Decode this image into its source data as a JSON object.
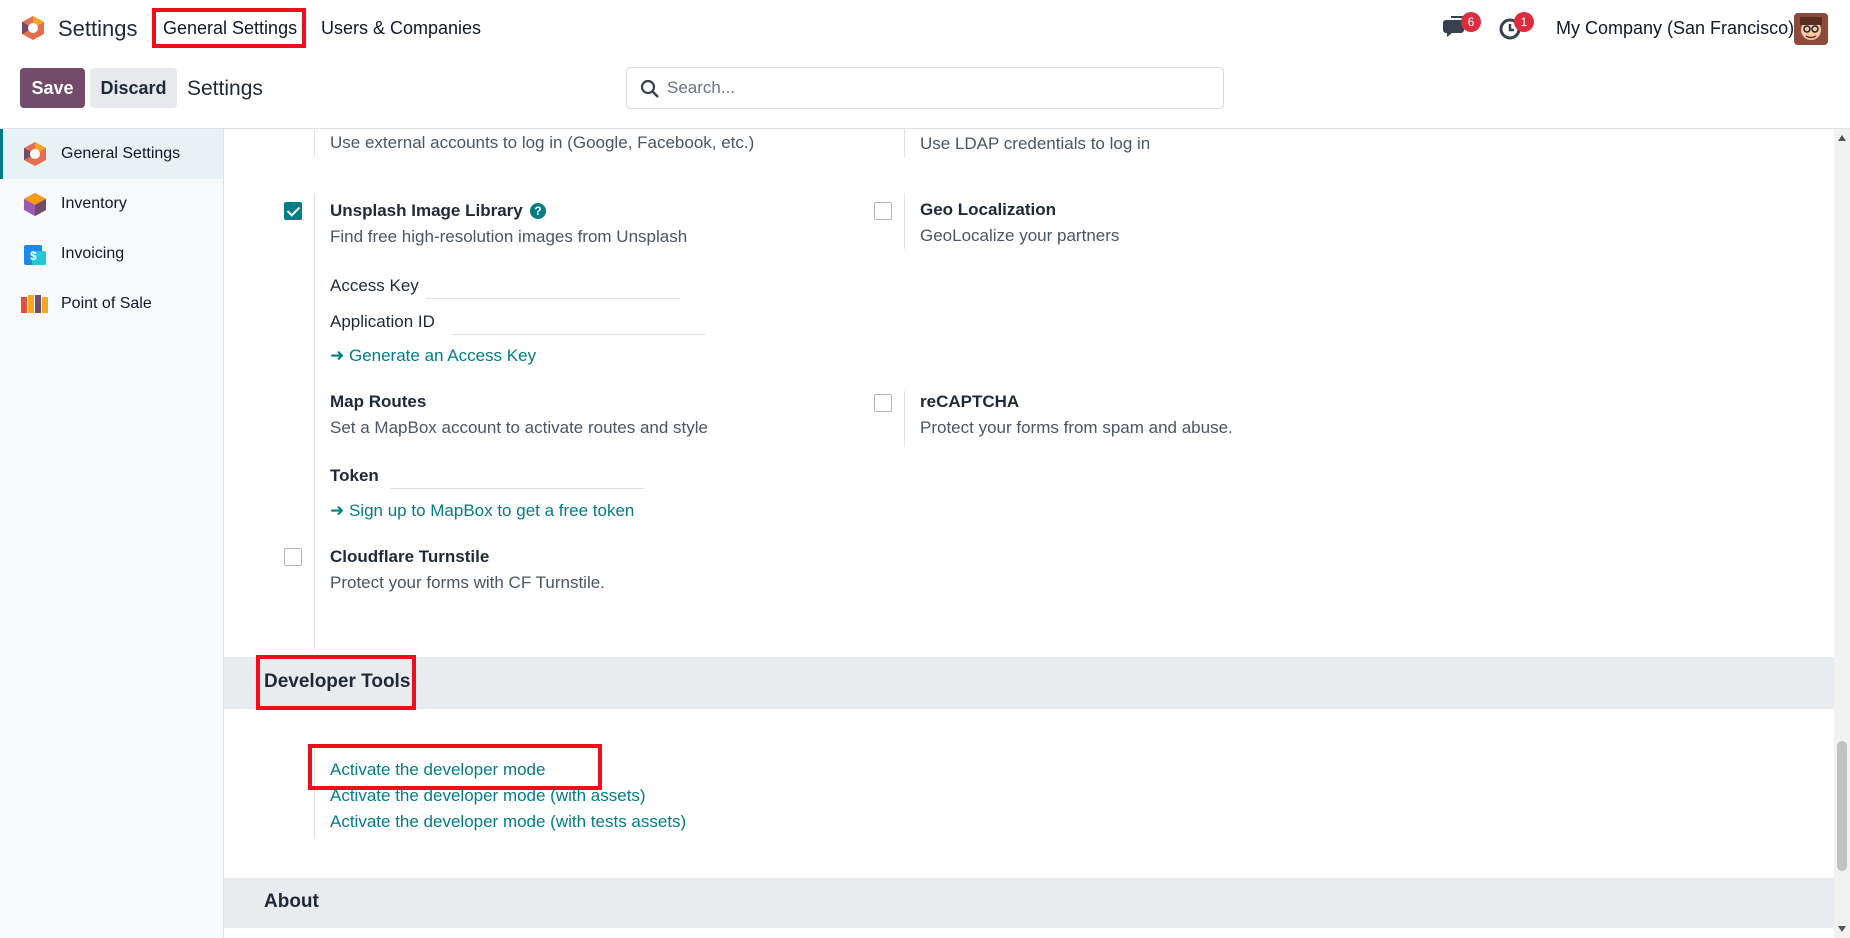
{
  "navbar": {
    "app_name": "Settings",
    "menus": [
      "General Settings",
      "Users & Companies"
    ],
    "chat_badge": "6",
    "activity_badge": "1",
    "company": "My Company (San Francisco)",
    "icons": {
      "logo": "odoo-logo-icon",
      "chat": "chat-icon",
      "activity": "clock-icon",
      "avatar": "user-avatar"
    }
  },
  "control_panel": {
    "save_label": "Save",
    "discard_label": "Discard",
    "breadcrumb": "Settings",
    "search_placeholder": "Search..."
  },
  "sidebar": {
    "items": [
      {
        "label": "General Settings",
        "icon": "settings-app-icon",
        "active": true
      },
      {
        "label": "Inventory",
        "icon": "inventory-app-icon",
        "active": false
      },
      {
        "label": "Invoicing",
        "icon": "invoicing-app-icon",
        "active": false
      },
      {
        "label": "Point of Sale",
        "icon": "pos-app-icon",
        "active": false
      }
    ]
  },
  "settings": {
    "oauth_desc": "Use external accounts to log in (Google, Facebook, etc.)",
    "ldap_desc": "Use LDAP credentials to log in",
    "unsplash": {
      "title": "Unsplash Image Library",
      "desc": "Find free high-resolution images from Unsplash",
      "checked": true,
      "access_key_label": "Access Key",
      "app_id_label": "Application ID",
      "generate_link": "➜ Generate an Access Key"
    },
    "geo": {
      "title": "Geo Localization",
      "desc": "GeoLocalize your partners",
      "checked": false
    },
    "map_routes": {
      "title": "Map Routes",
      "desc": "Set a MapBox account to activate routes and style",
      "token_label": "Token",
      "signup_link": "➜ Sign up to MapBox to get a free token"
    },
    "recaptcha": {
      "title": "reCAPTCHA",
      "desc": "Protect your forms from spam and abuse.",
      "checked": false
    },
    "turnstile": {
      "title": "Cloudflare Turnstile",
      "desc": "Protect your forms with CF Turnstile.",
      "checked": false
    }
  },
  "developer_tools": {
    "title": "Developer Tools",
    "links": [
      "Activate the developer mode",
      "Activate the developer mode (with assets)",
      "Activate the developer mode (with tests assets)"
    ]
  },
  "about": {
    "title": "About"
  },
  "colors": {
    "brand": "#714b67",
    "accent": "#017e84",
    "highlight": "#ee0f1a",
    "badge": "#dc2d3c"
  }
}
